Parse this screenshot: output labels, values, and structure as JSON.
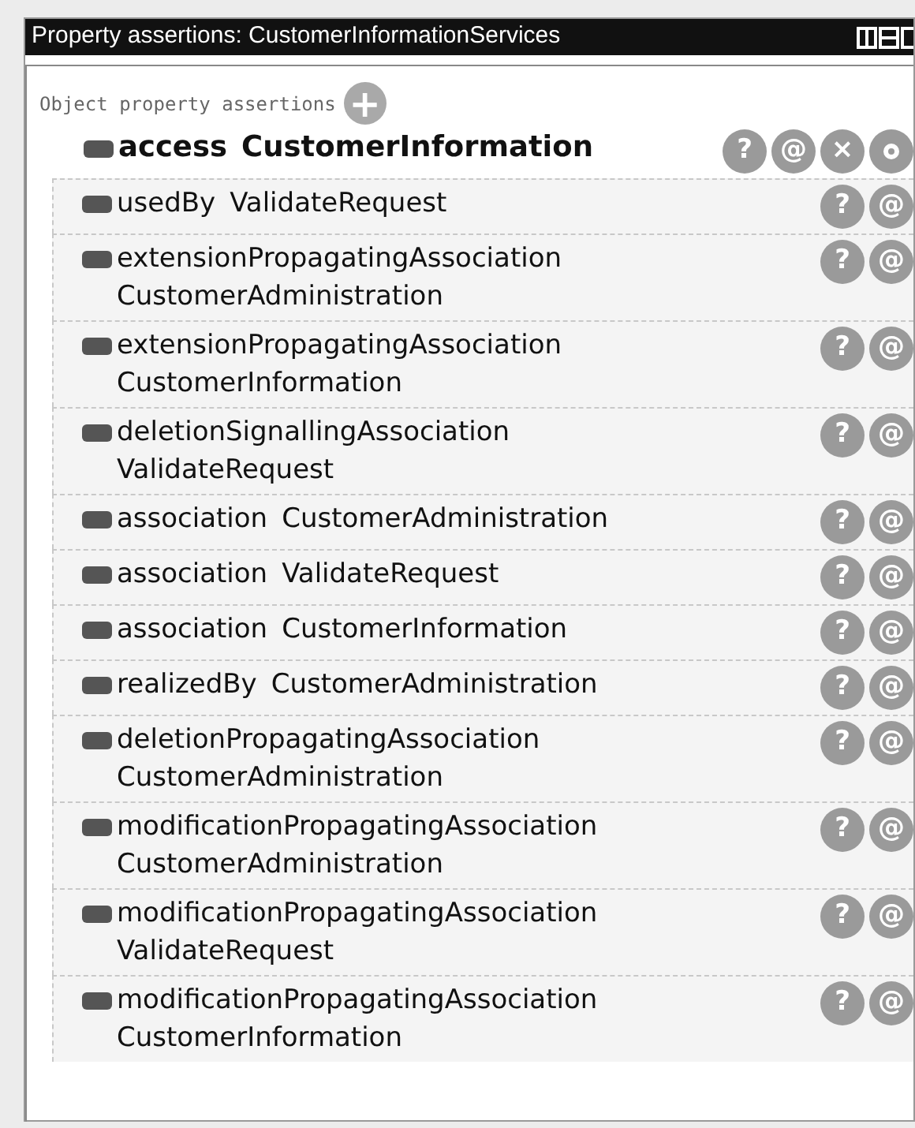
{
  "window": {
    "title": "Property assertions: CustomerInformationServices"
  },
  "section": {
    "label": "Object property assertions",
    "add_label": "+"
  },
  "header_row": {
    "property": "access",
    "value": "CustomerInformation",
    "buttons": [
      {
        "kind": "text",
        "label": "?"
      },
      {
        "kind": "text",
        "label": "@"
      },
      {
        "kind": "text",
        "label": "×"
      },
      {
        "kind": "circle"
      }
    ]
  },
  "rows": [
    {
      "property": "usedBy",
      "value": "ValidateRequest",
      "buttons": [
        {
          "kind": "text",
          "label": "?"
        },
        {
          "kind": "text",
          "label": "@"
        }
      ]
    },
    {
      "property": "extensionPropagatingAssociation",
      "value": "CustomerAdministration",
      "buttons": [
        {
          "kind": "text",
          "label": "?"
        },
        {
          "kind": "text",
          "label": "@"
        }
      ]
    },
    {
      "property": "extensionPropagatingAssociation",
      "value": "CustomerInformation",
      "buttons": [
        {
          "kind": "text",
          "label": "?"
        },
        {
          "kind": "text",
          "label": "@"
        }
      ]
    },
    {
      "property": "deletionSignallingAssociation",
      "value": "ValidateRequest",
      "buttons": [
        {
          "kind": "text",
          "label": "?"
        },
        {
          "kind": "text",
          "label": "@"
        }
      ]
    },
    {
      "property": "association",
      "value": "CustomerAdministration",
      "buttons": [
        {
          "kind": "text",
          "label": "?"
        },
        {
          "kind": "text",
          "label": "@"
        }
      ]
    },
    {
      "property": "association",
      "value": "ValidateRequest",
      "buttons": [
        {
          "kind": "text",
          "label": "?"
        },
        {
          "kind": "text",
          "label": "@"
        }
      ]
    },
    {
      "property": "association",
      "value": "CustomerInformation",
      "buttons": [
        {
          "kind": "text",
          "label": "?"
        },
        {
          "kind": "text",
          "label": "@"
        }
      ]
    },
    {
      "property": "realizedBy",
      "value": "CustomerAdministration",
      "buttons": [
        {
          "kind": "text",
          "label": "?"
        },
        {
          "kind": "text",
          "label": "@"
        }
      ]
    },
    {
      "property": "deletionPropagatingAssociation",
      "value": "CustomerAdministration",
      "buttons": [
        {
          "kind": "text",
          "label": "?"
        },
        {
          "kind": "text",
          "label": "@"
        }
      ]
    },
    {
      "property": "modificationPropagatingAssociation",
      "value": "CustomerAdministration",
      "buttons": [
        {
          "kind": "text",
          "label": "?"
        },
        {
          "kind": "text",
          "label": "@"
        }
      ]
    },
    {
      "property": "modificationPropagatingAssociation",
      "value": "ValidateRequest",
      "buttons": [
        {
          "kind": "text",
          "label": "?"
        },
        {
          "kind": "text",
          "label": "@"
        }
      ]
    },
    {
      "property": "modificationPropagatingAssociation",
      "value": "CustomerInformation",
      "buttons": [
        {
          "kind": "text",
          "label": "?"
        },
        {
          "kind": "text",
          "label": "@"
        }
      ]
    }
  ]
}
